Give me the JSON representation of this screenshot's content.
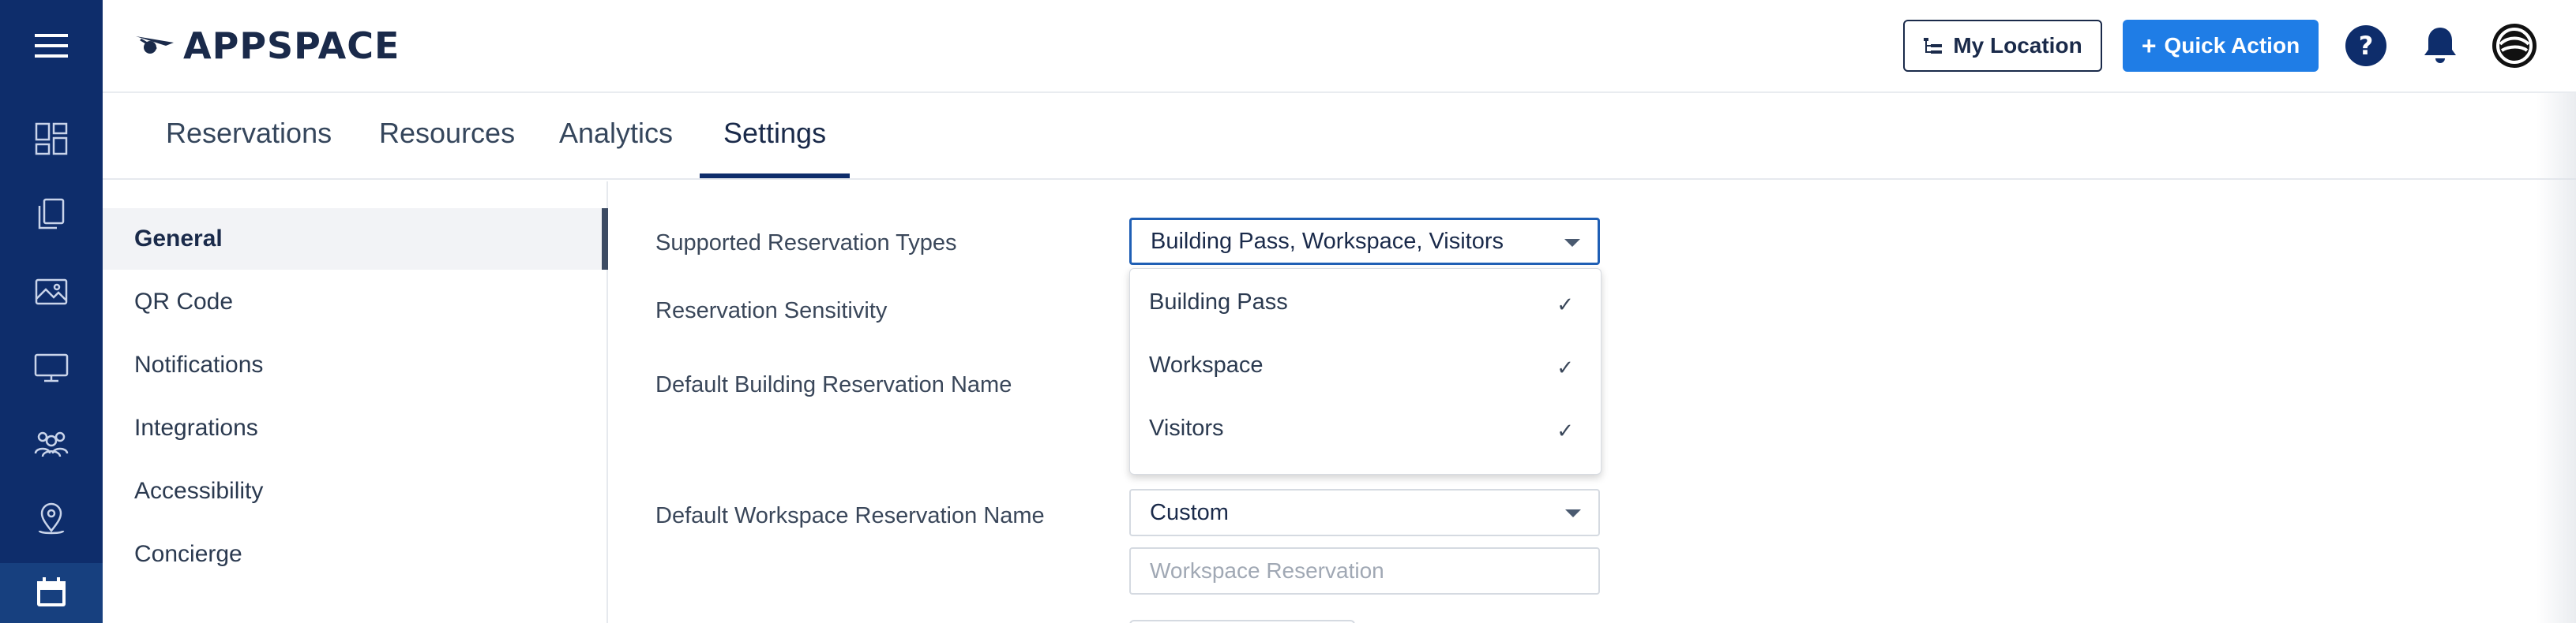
{
  "brand": {
    "logo_text": "APPSPACE",
    "color": "#0e2d6b"
  },
  "header": {
    "location_button": "My Location",
    "quick_action_button": "Quick Action",
    "accent": "#1f7de6"
  },
  "rail": {
    "items": [
      {
        "icon": "menu-icon"
      },
      {
        "icon": "dashboard-icon"
      },
      {
        "icon": "content-library-icon"
      },
      {
        "icon": "image-gallery-icon"
      },
      {
        "icon": "monitor-icon"
      },
      {
        "icon": "people-icon"
      },
      {
        "icon": "location-pin-icon"
      },
      {
        "icon": "calendar-icon",
        "active": true
      }
    ]
  },
  "tabs": [
    {
      "label": "Reservations"
    },
    {
      "label": "Resources"
    },
    {
      "label": "Analytics"
    },
    {
      "label": "Settings",
      "active": true
    }
  ],
  "settings_nav": [
    {
      "label": "General",
      "active": true
    },
    {
      "label": "QR Code"
    },
    {
      "label": "Notifications"
    },
    {
      "label": "Integrations"
    },
    {
      "label": "Accessibility"
    },
    {
      "label": "Concierge"
    }
  ],
  "form": {
    "supported_types": {
      "label": "Supported Reservation Types",
      "value": "Building Pass, Workspace, Visitors",
      "options": [
        {
          "label": "Building Pass",
          "checked": true
        },
        {
          "label": "Workspace",
          "checked": true
        },
        {
          "label": "Visitors",
          "checked": true
        }
      ]
    },
    "sensitivity": {
      "label": "Reservation Sensitivity"
    },
    "building_name": {
      "label": "Default Building Reservation Name"
    },
    "workspace_name": {
      "label": "Default Workspace Reservation Name",
      "value": "Custom",
      "placeholder": "Workspace Reservation"
    }
  },
  "check_glyph": "✓"
}
